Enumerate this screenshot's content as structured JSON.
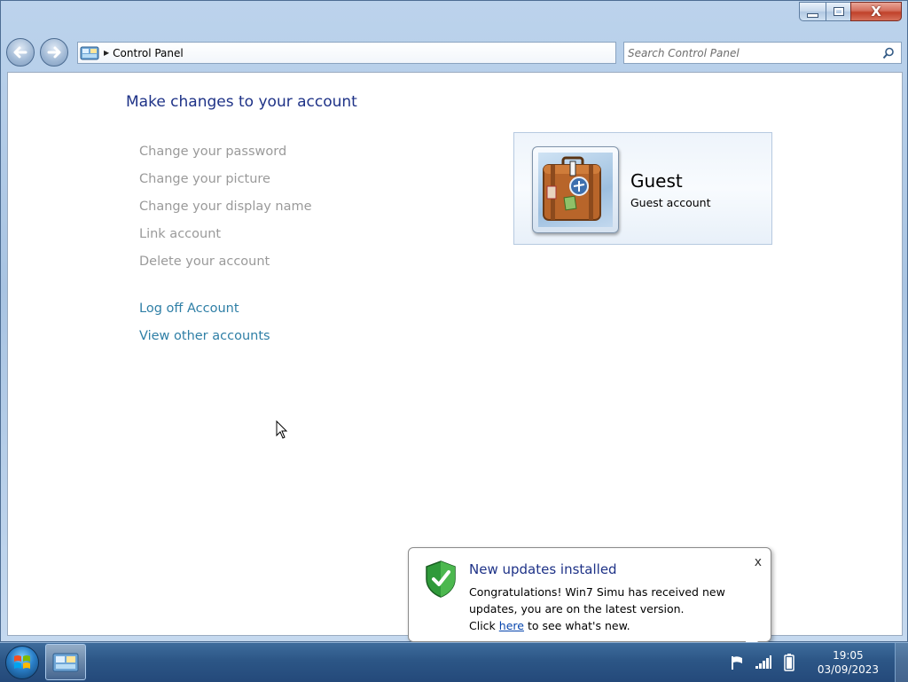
{
  "window": {
    "title": "Control Panel",
    "controls": {
      "minimize": "minimize",
      "maximize": "maximize",
      "close": "X"
    }
  },
  "address_bar": {
    "path": "Control Panel"
  },
  "search": {
    "placeholder": "Search Control Panel"
  },
  "main": {
    "title": "Make changes to your account",
    "tasks": [
      {
        "label": "Change your password"
      },
      {
        "label": "Change your picture"
      },
      {
        "label": "Change your display name"
      },
      {
        "label": "Link account"
      },
      {
        "label": "Delete your account"
      }
    ],
    "links": [
      {
        "label": "Log off Account"
      },
      {
        "label": "View other accounts"
      }
    ]
  },
  "account": {
    "name": "Guest",
    "type": "Guest account"
  },
  "notification": {
    "title": "New updates installed",
    "close_label": "x",
    "body_line1": "Congratulations! Win7 Simu has received new updates, you are on the latest version.",
    "body_pre": "Click",
    "link": "here",
    "body_post": "to see what's new."
  },
  "taskbar": {
    "clock_time": "19:05",
    "clock_date": "03/09/2023"
  },
  "colors": {
    "title_blue": "#1e3287",
    "link_teal": "#2f7fa6",
    "disabled_gray": "#9a9a9a"
  }
}
